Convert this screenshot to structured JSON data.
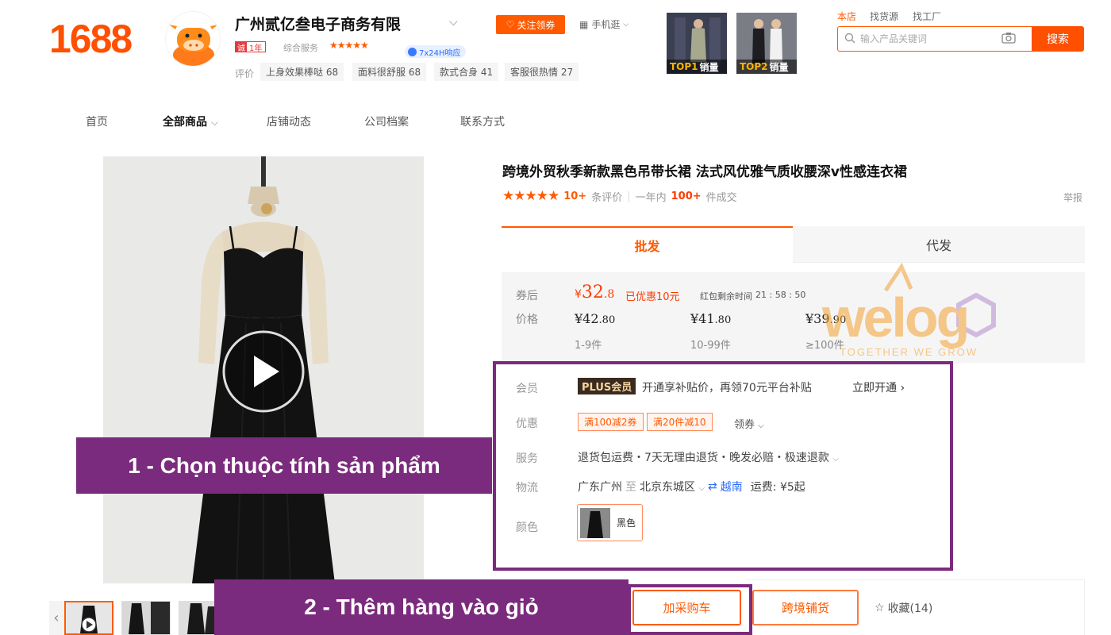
{
  "header": {
    "logo_text": "1688",
    "shop_name": "广州贰亿叁电子商务有限",
    "follow_label": "关注领券",
    "mobile_label": "手机逛",
    "year_badge_icon": "诚",
    "year_badge_text": "1年",
    "service_label": "综合服务",
    "service_stars": "★★★★★",
    "response_badge": "7x24H响应",
    "review_label": "评价",
    "review_tags": [
      "上身效果棒哒 68",
      "面料很舒服 68",
      "款式合身 41",
      "客服很热情 27"
    ],
    "top_products": [
      {
        "rank": "TOP1",
        "label": "销量"
      },
      {
        "rank": "TOP2",
        "label": "销量"
      }
    ],
    "search_tabs": [
      "本店",
      "找货源",
      "找工厂"
    ],
    "search_placeholder": "输入产品关键词",
    "search_button": "搜索"
  },
  "nav": {
    "items": [
      "首页",
      "全部商品",
      "店铺动态",
      "公司档案",
      "联系方式"
    ],
    "active_index": 1
  },
  "product": {
    "title": "跨境外贸秋季新款黑色吊带长裙 法式风优雅气质收腰深v性感连衣裙",
    "stars": "★★★★★",
    "review_count": "10+",
    "review_suffix": "条评价",
    "sales_prefix": "一年内",
    "sales_count": "100+",
    "sales_suffix": "件成交",
    "report": "举报",
    "tabs": [
      "批发",
      "代发"
    ],
    "price": {
      "after_coupon_label": "券后",
      "after_coupon_symbol": "¥",
      "after_coupon_int": "32",
      "after_coupon_dec": ".8",
      "discount_text": "已优惠10元",
      "countdown_label": "红包剩余时间",
      "countdown": "21 : 58 : 50",
      "price_label": "价格",
      "tiers": [
        {
          "int": "¥42",
          "dec": ".80",
          "range": "1-9件"
        },
        {
          "int": "¥41",
          "dec": ".80",
          "range": "10-99件"
        },
        {
          "int": "¥39",
          "dec": ".90",
          "range": "≥100件"
        }
      ]
    },
    "attrs": {
      "member_label": "会员",
      "plus_badge": "PLUS会员",
      "member_text": "开通享补贴价，再领70元平台补贴",
      "member_link": "立即开通",
      "promo_label": "优惠",
      "coupons": [
        "满100减2券",
        "满20件减10"
      ],
      "get_coupon": "领券",
      "service_label": "服务",
      "service_text": "退货包运费・7天无理由退货・晚发必赔・极速退款",
      "logistics_label": "物流",
      "ship_from": "广东广州",
      "ship_to_word": "至",
      "ship_to": "北京东城区",
      "country": "越南",
      "freight": "运费: ¥5起",
      "color_label": "颜色",
      "color_value": "黑色"
    }
  },
  "actions": {
    "add_to_cart": "加采购车",
    "cross_border": "跨境铺货",
    "favorite": "收藏(14)"
  },
  "overlays": {
    "step1": "1 - Chọn thuộc tính sản phẩm",
    "step2": "2 - Thêm hàng vào giỏ"
  },
  "watermark": {
    "brand": "welog",
    "tagline": "TOGETHER WE GROW"
  }
}
